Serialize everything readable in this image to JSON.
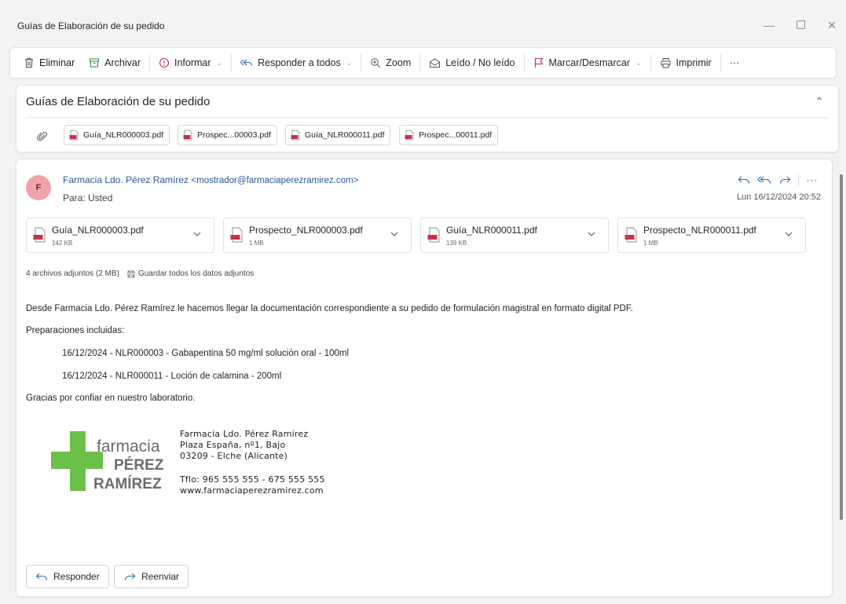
{
  "window": {
    "title": "Guías de Elaboración de su pedido",
    "minimize_icon": "minimize-icon",
    "maximize_icon": "maximize-icon",
    "close_icon": "close-icon"
  },
  "toolbar": {
    "items": [
      {
        "label": "Eliminar",
        "icon": "trash-icon"
      },
      {
        "label": "Archivar",
        "icon": "archive-icon"
      },
      {
        "label": "Informar",
        "icon": "report-icon",
        "dropdown": true
      },
      {
        "label": "Responder a todos",
        "icon": "reply-all-icon",
        "dropdown": true
      },
      {
        "label": "Zoom",
        "icon": "zoom-icon"
      },
      {
        "label": "Leído / No leído",
        "icon": "envelope-open-icon"
      },
      {
        "label": "Marcar/Desmarcar",
        "icon": "flag-icon",
        "dropdown": true
      },
      {
        "label": "Imprimir",
        "icon": "print-icon"
      },
      {
        "label": "···",
        "icon": "more-icon"
      }
    ]
  },
  "thread": {
    "subject": "Guías de Elaboración de su pedido",
    "chips": [
      "Guía_NLR000003.pdf",
      "Prospec...00003.pdf",
      "Guía_NLR000011.pdf",
      "Prospec...00011.pdf"
    ]
  },
  "message": {
    "avatar_initial": "F",
    "sender_name": "Farmacia Ldo. Pérez Ramírez",
    "sender_email": "<mostrador@farmaciaperezramirez.com>",
    "to": "Para:  Usted",
    "date": "Lun 16/12/2024 20:52",
    "attachments": [
      {
        "name": "Guía_NLR000003.pdf",
        "size": "142 KB"
      },
      {
        "name": "Prospecto_NLR000003.pdf",
        "size": "1 MB"
      },
      {
        "name": "Guía_NLR000011.pdf",
        "size": "139 KB"
      },
      {
        "name": "Prospecto_NLR000011.pdf",
        "size": "1 MB"
      }
    ],
    "attachment_count": "4 archivos adjuntos (2 MB)",
    "save_all": "Guardar todos los datos adjuntos",
    "body": {
      "intro": "Desde Farmacia Ldo. Pérez Ramírez le hacemos llegar la documentación correspondiente a su pedido de formulación magistral en formato digital PDF.",
      "preparations_label": "Preparaciones incluidas:",
      "preparations": [
        "16/12/2024 - NLR000003 - Gabapentina 50 mg/ml solución oral - 100ml",
        "16/12/2024 - NLR000011 - Loción de calamina - 200ml"
      ],
      "closing": "Gracias por confiar en nuestro laboratorio."
    },
    "signature": {
      "logo_word1": "farmacia",
      "logo_word2": "PÉREZ",
      "logo_word3": "RAMÍREZ",
      "lines": [
        "Farmacia Ldo. Pérez Ramírez",
        "Plaza España, nº1, Bajo",
        "03209 - Elche (Alicante)",
        "Tflo: 965 555 555 - 675 555 555",
        "www.farmaciaperezramirez.com"
      ]
    },
    "actions": {
      "reply": "Responder",
      "forward": "Reenviar"
    }
  },
  "colors": {
    "accent": "#2b66b8",
    "pdf_red": "#c4314b",
    "logo_green": "#6cc04a",
    "logo_gray": "#6b6b6b"
  }
}
